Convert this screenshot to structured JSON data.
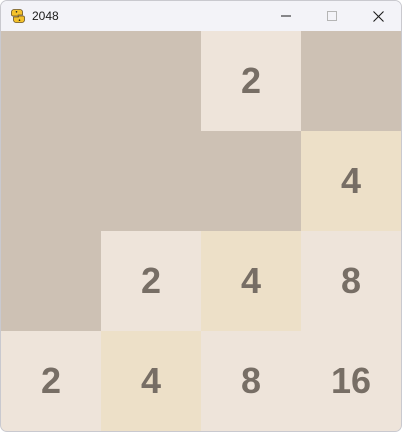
{
  "window": {
    "title": "2048",
    "icon": "python-snake-icon"
  },
  "colors": {
    "empty_cell": "#cdc1b4",
    "tile_2": "#eee4da",
    "tile_4": "#ede0c8",
    "tile_8": "#eee4da",
    "tile_16": "#eee4da",
    "tile_text": "#776e65",
    "titlebar": "#f3f3f8"
  },
  "board": {
    "cells": [
      "",
      "",
      "2",
      "",
      "",
      "",
      "",
      "4",
      "",
      "2",
      "4",
      "8",
      "2",
      "4",
      "8",
      "16"
    ]
  }
}
